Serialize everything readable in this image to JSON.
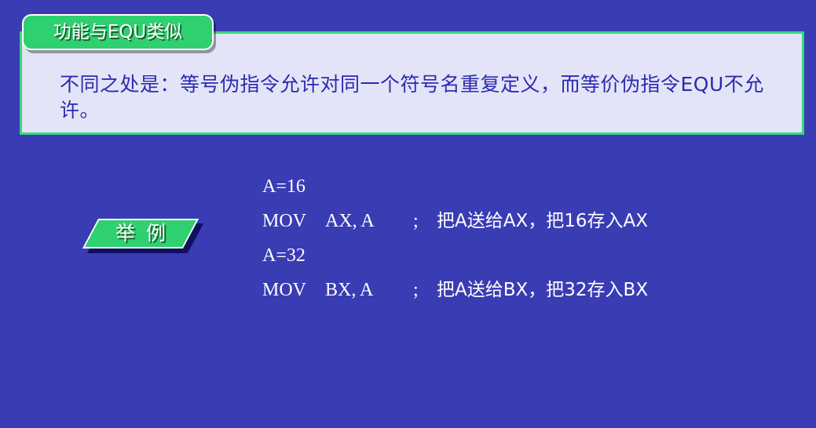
{
  "callout": {
    "tab_label": "功能与EQU类似",
    "text": "不同之处是：等号伪指令允许对同一个符号名重复定义，而等价伪指令EQU不允许。"
  },
  "example": {
    "label": "举例",
    "lines": [
      {
        "op": "A=16",
        "args": "",
        "semi": "",
        "comment": ""
      },
      {
        "op": "MOV",
        "args": "AX, A",
        "semi": ";",
        "comment": "把A送给AX，把16存入AX"
      },
      {
        "op": "A=32",
        "args": "",
        "semi": "",
        "comment": ""
      },
      {
        "op": "MOV",
        "args": "BX, A",
        "semi": ";",
        "comment": "把A送给BX，把32存入BX"
      }
    ]
  },
  "colors": {
    "background": "#3a3cb4",
    "accent_green": "#2fd06f",
    "callout_fill": "#e4e4f8",
    "callout_text": "#2b2bb0"
  }
}
